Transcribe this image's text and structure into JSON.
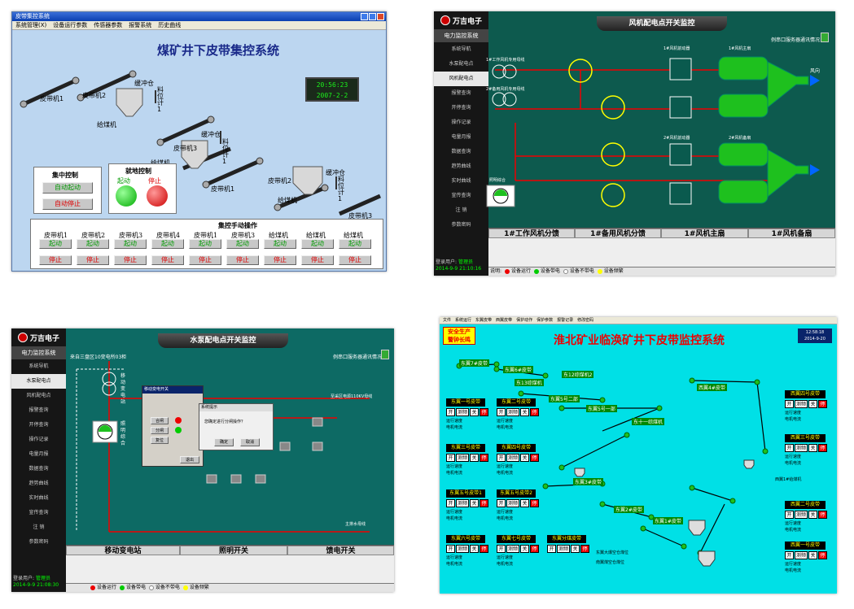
{
  "p1": {
    "window_title": "皮带集控系统",
    "menus": [
      "系统管理(X)",
      "设备运行参数",
      "传感器参数",
      "报警系统",
      "历史曲线"
    ],
    "title": "煤矿井下皮带集控系统",
    "clock_time": "20:56:23",
    "clock_date": "2007-2-2",
    "belts": [
      "皮带机1",
      "皮带机2",
      "皮带机3",
      "皮带机1",
      "皮带机2",
      "皮带机3"
    ],
    "bins": [
      "缓冲仓",
      "缓冲仓",
      "缓冲仓"
    ],
    "level_sensor": "料位计1",
    "feeders": [
      "给煤机",
      "给煤机",
      "给煤机"
    ],
    "central_title": "集中控制",
    "auto_start": "自动起动",
    "auto_stop": "自动停止",
    "local_title": "就地控制",
    "local_start": "起动",
    "local_stop": "停止",
    "manual_title": "集控手动操作",
    "manual_cols": [
      "皮带机1",
      "皮带机2",
      "皮带机3",
      "皮带机4",
      "皮带机1",
      "皮带机3",
      "给煤机",
      "给煤机",
      "给煤机"
    ],
    "btn_start": "起动",
    "btn_stop": "停止"
  },
  "p2": {
    "company": "万吉电子",
    "side_header": "电力监控系统",
    "side_items": [
      "系统导航",
      "水泵配电点",
      "风机配电点",
      "报警查询",
      "开停查询",
      "操作记录",
      "电量月报",
      "数据查询",
      "趋势曲线",
      "实时曲线",
      "宣传查询",
      "注  销",
      "参数密码"
    ],
    "title": "风机配电点开关监控",
    "comm_status": "例串口服务器通讯情况",
    "wind_dir": "风向",
    "lighting": "照明综合",
    "fans": [
      "1#风机前动器",
      "1#风机主扇",
      "2#风机前动器",
      "2#风机备扇"
    ],
    "feeds": [
      "1#工作风机专用母线",
      "2#备用风机专用母线"
    ],
    "table_headers": [
      "1#工作风机分馈",
      "1#备用风机分馈",
      "1#风机主扇",
      "1#风机备扇"
    ],
    "legend": [
      "设备运行",
      "设备带电",
      "设备不带电",
      "设备频繁"
    ],
    "user_label": "登录用户:",
    "user": "管理员",
    "datetime": "2014-9-9 21:10:16",
    "btn_close": "说明:"
  },
  "p3": {
    "company": "万吉电子",
    "side_header": "电力监控系统",
    "side_items": [
      "系统导航",
      "水泵配电点",
      "风机配电点",
      "报警查询",
      "开停查询",
      "操作记录",
      "电量月报",
      "数据查询",
      "趋势曲线",
      "实时曲线",
      "宣传查询",
      "注  销",
      "参数密码"
    ],
    "title": "水泵配电点开关监控",
    "comm_status": "例串口服务器通讯情况",
    "source": "来自三盘区10变电所03柜",
    "mobile_sub": "移动变电站",
    "lighting": "照明综合",
    "dialog_title": "移动变电开关",
    "dialog_btns": [
      "合闸",
      "分闸",
      "复位"
    ],
    "dialog_exit": "退出",
    "confirm_title": "系统提示",
    "confirm_msg": "您确定进行分闸操作？",
    "confirm_ok": "确定",
    "confirm_cancel": "取消",
    "bus_label": "至采区电源110KV母线",
    "bus_label2": "主排水母线",
    "table_headers": [
      "移动变电站",
      "照明开关",
      "馈电开关"
    ],
    "legend": [
      "设备运行",
      "设备带电",
      "设备不带电",
      "设备频繁"
    ],
    "user_label": "登录用户:",
    "user": "管理员",
    "datetime": "2014-9-9 21:08:30"
  },
  "p4": {
    "menus": [
      "文件",
      "系统运行",
      "东翼皮带",
      "西翼皮带",
      "保护动作",
      "保护参数",
      "报警记录",
      "修改密码"
    ],
    "slogan1": "安全生产",
    "slogan2": "警钟长鸣",
    "title": "淮北矿业临涣矿井下皮带监控系统",
    "clock_time": "12:58:18",
    "clock_date": "2014-9-20",
    "belts": [
      "东翼7#皮带",
      "东翼6#皮带",
      "东13综煤机",
      "东12综煤机2",
      "东翼5号二部",
      "东翼5号一部",
      "东十一综煤机",
      "东翼3#皮带",
      "东翼2#皮带",
      "东翼1#皮带",
      "西翼4#皮带"
    ],
    "controls": [
      "东翼一号皮带",
      "东翼二号皮带",
      "东翼三号皮带",
      "东翼四号皮带",
      "东翼五号皮带1",
      "东翼五号皮带2",
      "东翼六号皮带",
      "东翼七号皮带",
      "东翼分煤皮带",
      "西翼四号皮带",
      "西翼三号皮带",
      "西翼二号皮带",
      "西翼一号皮带"
    ],
    "btn_open": "开",
    "btn_test": "测频",
    "btn_close": "关",
    "btn_stop": "停",
    "speed_label": "运行速度",
    "current_label": "电机电流",
    "bin_label1": "东翼大爆空仓煤位",
    "bin_label2": "南翼煤空仓煤位",
    "feeder_label": "西翼1#给煤机"
  },
  "colors": {
    "p1_bg": "#bcd6f0",
    "p2_bg": "#0d5a4e",
    "p3_bg": "#0d6a64",
    "p4_bg": "#00e0e6",
    "fan_green": "#1ec01e",
    "alarm_red": "#e00000"
  }
}
